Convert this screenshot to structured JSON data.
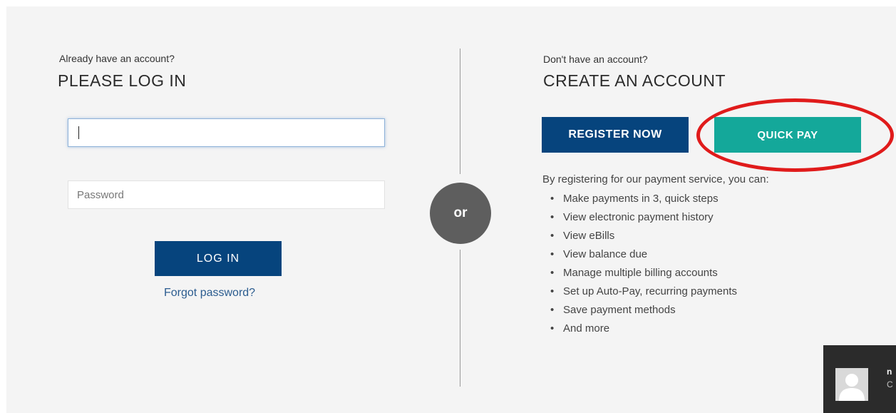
{
  "login": {
    "subtitle": "Already have an account?",
    "title": "PLEASE LOG IN",
    "username_value": "",
    "password_placeholder": "Password",
    "login_button": "LOG IN",
    "forgot_link": "Forgot password?"
  },
  "divider": {
    "or_label": "or"
  },
  "create": {
    "subtitle": "Don't have an account?",
    "title": "CREATE AN ACCOUNT",
    "register_button": "REGISTER NOW",
    "quick_pay_button": "QUICK PAY",
    "benefits_intro": "By registering for our payment service, you can:",
    "benefits": [
      "Make payments in 3, quick steps",
      "View electronic payment history",
      "View eBills",
      "View balance due",
      "Manage multiple billing accounts",
      "Set up Auto-Pay, recurring payments",
      "Save payment methods",
      "And more"
    ]
  },
  "chat_widget": {
    "name": "n",
    "subtitle": "C"
  },
  "colors": {
    "primary_navy": "#06447d",
    "quick_pay_teal": "#14a89a",
    "highlight_red": "#e01b1b",
    "link_blue": "#2b5c8f",
    "or_circle": "#5e5e5e",
    "panel_background": "#f4f4f4"
  },
  "icons": {
    "chat_avatar": "user-silhouette-icon",
    "list_bullet": "bullet-dot-icon"
  }
}
